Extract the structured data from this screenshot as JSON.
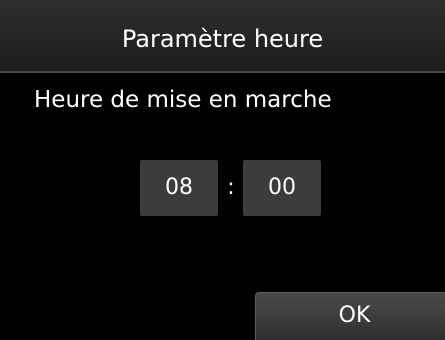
{
  "header": {
    "title": "Paramètre heure"
  },
  "setting": {
    "label": "Heure de mise en marche"
  },
  "time": {
    "hours": "08",
    "separator": ":",
    "minutes": "00"
  },
  "actions": {
    "ok_label": "OK"
  },
  "colors": {
    "background": "#000000",
    "title_bar": "#262626",
    "time_box": "#3c3c3c",
    "text": "#ffffff"
  }
}
